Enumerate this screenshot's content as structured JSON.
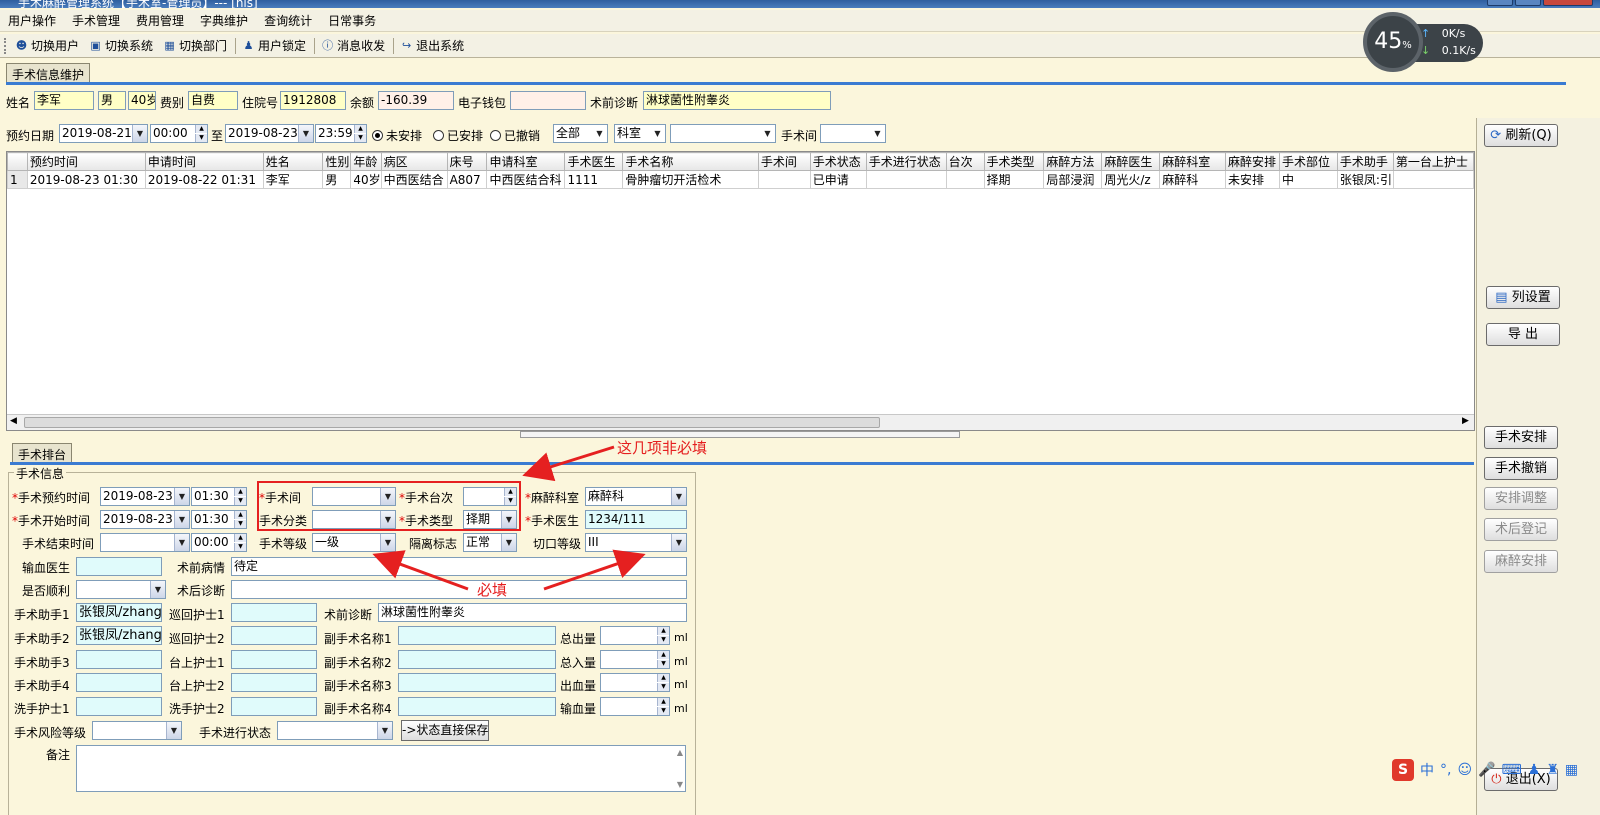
{
  "window": {
    "title": "手术麻醉管理系统【手术室-管理员】--- [his]"
  },
  "menu": [
    "用户操作",
    "手术管理",
    "费用管理",
    "字典维护",
    "查询统计",
    "日常事务"
  ],
  "toolbar": [
    {
      "label": "切换用户",
      "icon": "switch-user-icon"
    },
    {
      "label": "切换系统",
      "icon": "switch-system-icon"
    },
    {
      "label": "切换部门",
      "icon": "switch-dept-icon"
    },
    {
      "label": "用户锁定",
      "icon": "user-lock-icon"
    },
    {
      "label": "消息收发",
      "icon": "message-icon"
    },
    {
      "label": "退出系统",
      "icon": "exit-system-icon"
    }
  ],
  "network": {
    "percent": "45",
    "percent_unit": "%",
    "up": "0K/s",
    "down": "0.1K/s"
  },
  "maint_tab": "手术信息维护",
  "patient": {
    "name_label": "姓名",
    "name": "李军",
    "gender": "男",
    "age": "40岁",
    "fee_label": "费别",
    "fee": "自费",
    "inpatient_label": "住院号",
    "inpatient": "1912808",
    "balance_label": "余额",
    "balance": "-160.39",
    "wallet_label": "电子钱包",
    "wallet": "",
    "diag_label": "术前诊断",
    "diag": "淋球菌性附睾炎"
  },
  "filter": {
    "date_label": "预约日期",
    "from_date": "2019-08-21",
    "from_time": "00:00",
    "to_label": "至",
    "to_date": "2019-08-23",
    "to_time": "23:59",
    "radios": [
      {
        "label": "未安排",
        "checked": true
      },
      {
        "label": "已安排",
        "checked": false
      },
      {
        "label": "已撤销",
        "checked": false
      }
    ],
    "scope": "全部",
    "dept": "科室",
    "dept_value": "",
    "room_label": "手术间",
    "room": ""
  },
  "grid": {
    "columns": [
      "",
      "预约时间",
      "申请时间",
      "姓名",
      "性别",
      "年龄",
      "病区",
      "床号",
      "申请科室",
      "手术医生",
      "手术名称",
      "手术间",
      "手术状态",
      "手术进行状态",
      "台次",
      "手术类型",
      "麻醉方法",
      "麻醉医生",
      "麻醉科室",
      "麻醉安排",
      "手术部位",
      "手术助手",
      "第一台上护士"
    ],
    "rows": [
      [
        "1",
        "2019-08-23 01:30",
        "2019-08-22 01:31",
        "李军",
        "男",
        "40岁",
        "中西医结合",
        "A807",
        "中西医结合科",
        "1111",
        "骨肿瘤切开活检术",
        "",
        "已申请",
        "",
        "",
        "择期",
        "局部浸润",
        "周光火/z",
        "麻醉科",
        "未安排",
        "中",
        "张银凤:引",
        ""
      ]
    ]
  },
  "right_buttons": {
    "refresh": "刷新(Q)",
    "col_settings": "列设置",
    "export": "导 出",
    "arrange": "手术安排",
    "cancel": "手术撤销",
    "adjust": "安排调整",
    "post_reg": "术后登记",
    "anes_arrange": "麻醉安排",
    "exit": "退出(X)"
  },
  "sched_tab": "手术排台",
  "form": {
    "group": "手术信息",
    "appt_time_label": "手术预约时间",
    "appt_date": "2019-08-23",
    "appt_time": "01:30",
    "start_time_label": "手术开始时间",
    "start_date": "2019-08-23",
    "start_time": "01:30",
    "end_time_label": "手术结束时间",
    "end_date": "",
    "end_time": "00:00",
    "room_label": "手术间",
    "room": "",
    "seq_label": "手术台次",
    "seq": "",
    "anes_dept_label": "麻醉科室",
    "anes_dept": "麻醉科",
    "category_label": "手术分类",
    "category": "",
    "type_label": "手术类型",
    "type": "择期",
    "doctor_label": "手术医生",
    "doctor": "1234/111",
    "level_label": "手术等级",
    "level": "一级",
    "isolation_label": "隔离标志",
    "isolation": "正常",
    "incision_label": "切口等级",
    "incision": "III",
    "transfusion_doctor_label": "输血医生",
    "transfusion_doctor": "",
    "pre_condition_label": "术前病情",
    "pre_condition": "待定",
    "smooth_label": "是否顺利",
    "smooth": "",
    "post_diag_label": "术后诊断",
    "post_diag": "",
    "pre_diag_label": "术前诊断",
    "pre_diag": "淋球菌性附睾炎",
    "assistants": [
      {
        "label": "手术助手1",
        "value": "张银凤/zhang"
      },
      {
        "label": "手术助手2",
        "value": "张银凤/zhang"
      },
      {
        "label": "手术助手3",
        "value": ""
      },
      {
        "label": "手术助手4",
        "value": ""
      },
      {
        "label": "洗手护士1",
        "value": ""
      }
    ],
    "nurses": [
      {
        "label": "巡回护士1",
        "value": ""
      },
      {
        "label": "巡回护士2",
        "value": ""
      },
      {
        "label": "台上护士1",
        "value": ""
      },
      {
        "label": "台上护士2",
        "value": ""
      },
      {
        "label": "洗手护士2",
        "value": ""
      }
    ],
    "sub_ops": [
      {
        "label": "副手术名称1",
        "value": ""
      },
      {
        "label": "副手术名称2",
        "value": ""
      },
      {
        "label": "副手术名称3",
        "value": ""
      },
      {
        "label": "副手术名称4",
        "value": ""
      }
    ],
    "volumes": [
      {
        "label": "总出量",
        "value": "",
        "unit": "ml"
      },
      {
        "label": "总入量",
        "value": "",
        "unit": "ml"
      },
      {
        "label": "出血量",
        "value": "",
        "unit": "ml"
      },
      {
        "label": "输血量",
        "value": "",
        "unit": "ml"
      }
    ],
    "risk_label": "手术风险等级",
    "risk": "",
    "progress_label": "手术进行状态",
    "progress": "",
    "save_status": "->状态直接保存",
    "remarks_label": "备注",
    "remarks": ""
  },
  "annotations": {
    "optional": "这几项非必填",
    "required": "必填"
  },
  "ime": {
    "lang": "中",
    "punct": "°,"
  }
}
